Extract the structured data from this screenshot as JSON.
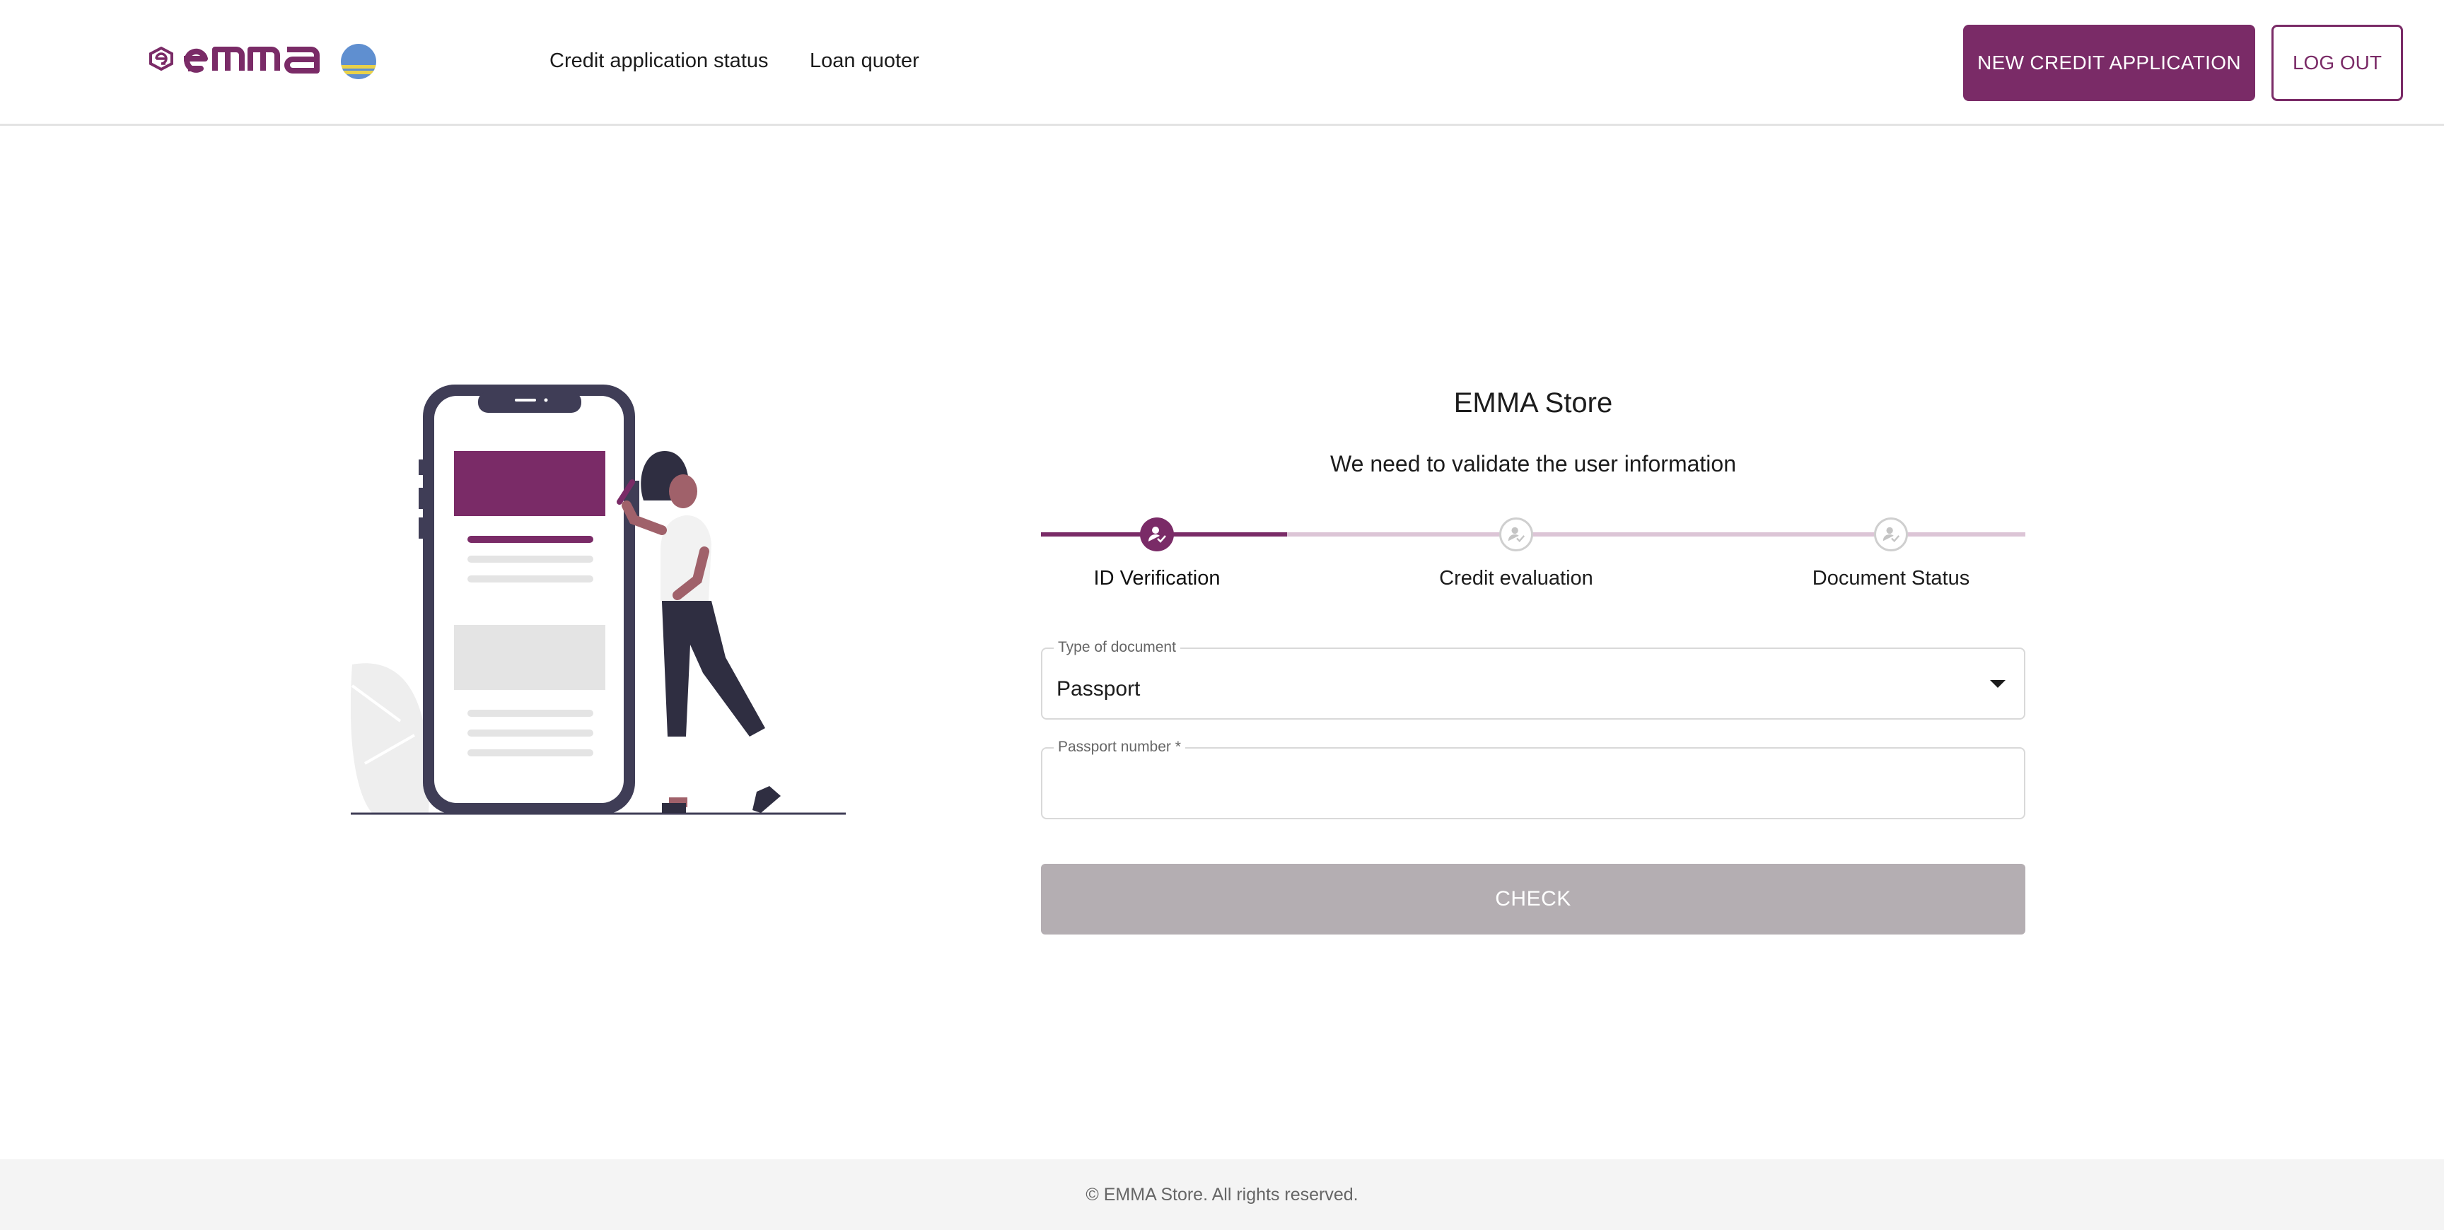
{
  "colors": {
    "brand": "#7a2b67",
    "brand_light": "#dcc5d6",
    "disabled_button": "#b4aeb2",
    "footer_bg": "#f4f4f4"
  },
  "header": {
    "logo_icon": "emma-logo-icon",
    "flag_icon": "flag-icon",
    "nav": [
      {
        "label": "Credit application status"
      },
      {
        "label": "Loan quoter"
      }
    ],
    "new_application_label": "NEW CREDIT APPLICATION",
    "logout_label": "LOG OUT"
  },
  "illustration": {
    "name": "woman-with-phone-illustration"
  },
  "form": {
    "store_title": "EMMA Store",
    "subtitle": "We need to validate the user information",
    "steps": [
      {
        "label": "ID Verification",
        "icon": "user-check-icon",
        "active": true
      },
      {
        "label": "Credit evaluation",
        "icon": "user-check-icon",
        "active": false
      },
      {
        "label": "Document Status",
        "icon": "user-check-icon",
        "active": false
      }
    ],
    "document_type": {
      "label": "Type of document",
      "value": "Passport"
    },
    "passport_number": {
      "label": "Passport number *",
      "value": ""
    },
    "check_label": "CHECK"
  },
  "footer": {
    "text": "© EMMA Store. All rights reserved."
  }
}
